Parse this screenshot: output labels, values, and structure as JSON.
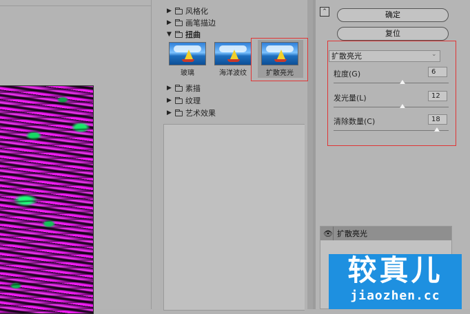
{
  "gallery": {
    "categories_top": [
      {
        "label": "风格化",
        "expanded": false
      },
      {
        "label": "画笔描边",
        "expanded": false
      },
      {
        "label": "扭曲",
        "expanded": true
      }
    ],
    "distort_filters": [
      {
        "label": "玻璃",
        "selected": false
      },
      {
        "label": "海洋波纹",
        "selected": false
      },
      {
        "label": "扩散亮光",
        "selected": true
      }
    ],
    "categories_bottom": [
      {
        "label": "素描",
        "expanded": false
      },
      {
        "label": "纹理",
        "expanded": false
      },
      {
        "label": "艺术效果",
        "expanded": false
      }
    ]
  },
  "actions": {
    "ok_label": "确定",
    "reset_label": "复位",
    "collapse_glyph": "⌃"
  },
  "settings": {
    "filter_select": "扩散亮光",
    "params": [
      {
        "label": "粒度(G)",
        "value": "6",
        "fraction": 0.6
      },
      {
        "label": "发光量(L)",
        "value": "12",
        "fraction": 0.6
      },
      {
        "label": "清除数量(C)",
        "value": "18",
        "fraction": 0.9
      }
    ]
  },
  "effect_layers": {
    "layer_name": "扩散亮光",
    "visibility_icon": "eye-icon"
  },
  "watermark": {
    "title": "较真儿",
    "url": "jiaozhen.cc"
  },
  "colors": {
    "highlight_box": "#e03535",
    "preview_magenta": "#ff21ff",
    "preview_green": "#1cff78",
    "watermark_blue": "#1e90e0"
  }
}
